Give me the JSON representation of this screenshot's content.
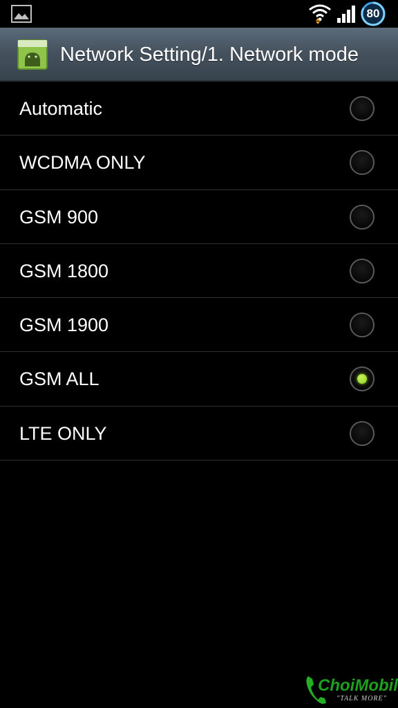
{
  "status_bar": {
    "battery_level": "80",
    "icons": [
      "gallery-icon",
      "wifi-icon",
      "signal-icon",
      "battery-icon"
    ]
  },
  "action_bar": {
    "title": "Network Setting/1. Network mode",
    "app_icon": "android-app-icon"
  },
  "options": [
    {
      "label": "Automatic",
      "selected": false
    },
    {
      "label": "WCDMA ONLY",
      "selected": false
    },
    {
      "label": "GSM 900",
      "selected": false
    },
    {
      "label": "GSM 1800",
      "selected": false
    },
    {
      "label": "GSM 1900",
      "selected": false
    },
    {
      "label": "GSM ALL",
      "selected": true
    },
    {
      "label": "LTE ONLY",
      "selected": false
    }
  ],
  "watermark": {
    "brand": "ChoiMobile",
    "tagline": "\"TALK MORE\""
  },
  "colors": {
    "background": "#000000",
    "action_bar": "#46535f",
    "radio_selected": "#8ccf1e",
    "divider": "#2e2e2e"
  }
}
